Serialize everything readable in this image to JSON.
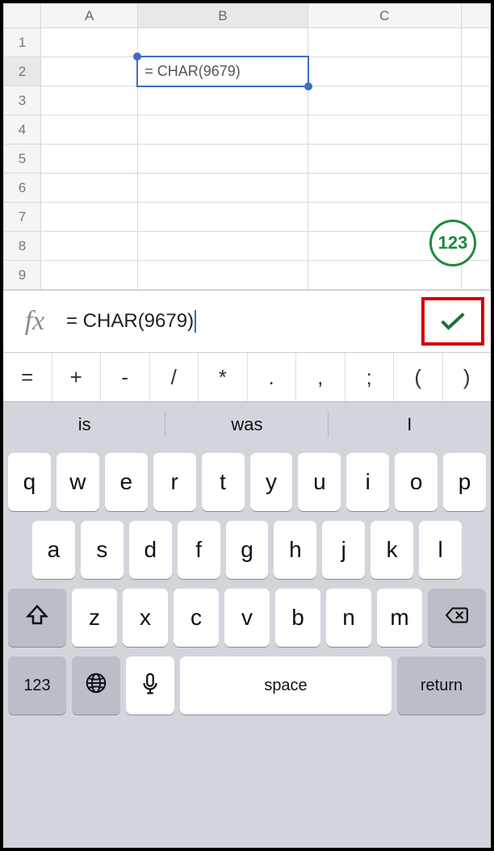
{
  "columns": [
    "A",
    "B",
    "C"
  ],
  "rows": [
    "1",
    "2",
    "3",
    "4",
    "5",
    "6",
    "7",
    "8",
    "9"
  ],
  "active_cell": {
    "col": "B",
    "row": "2",
    "display": "= CHAR(9679)"
  },
  "numeric_toggle": "123",
  "formula_bar": {
    "fx_label": "fx",
    "value": "= CHAR(9679)"
  },
  "operators": [
    "=",
    "+",
    "-",
    "/",
    "*",
    ".",
    ",",
    ";",
    "(",
    ")"
  ],
  "suggestions": [
    "is",
    "was",
    "I"
  ],
  "keyboard": {
    "row1": [
      "q",
      "w",
      "e",
      "r",
      "t",
      "y",
      "u",
      "i",
      "o",
      "p"
    ],
    "row2": [
      "a",
      "s",
      "d",
      "f",
      "g",
      "h",
      "j",
      "k",
      "l"
    ],
    "row3": [
      "z",
      "x",
      "c",
      "v",
      "b",
      "n",
      "m"
    ],
    "numswitch": "123",
    "space": "space",
    "return": "return"
  }
}
